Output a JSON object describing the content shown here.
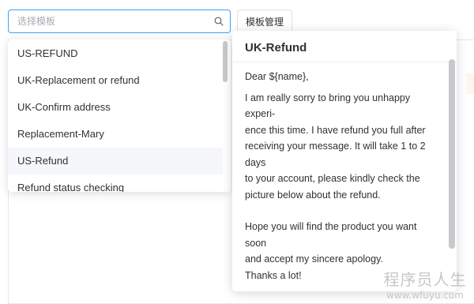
{
  "search": {
    "placeholder": "选择模板",
    "icon": "search-icon"
  },
  "toolbar": {
    "manage_label": "模板管理"
  },
  "dropdown": {
    "items": [
      {
        "label": "US-REFUND"
      },
      {
        "label": "UK-Replacement or refund"
      },
      {
        "label": "UK-Confirm address"
      },
      {
        "label": "Replacement-Mary"
      },
      {
        "label": "US-Refund"
      },
      {
        "label": "Refund status checking"
      }
    ],
    "hovered_index": 4
  },
  "preview": {
    "title": "UK-Refund",
    "greeting": "Dear ${name},",
    "lines_1": [
      "I am really sorry to bring you unhappy experi-",
      "ence this time. I have refund you full after",
      "receiving your message. It will take 1 to 2 days",
      "to your account, please kindly check the",
      "picture below about the refund."
    ],
    "lines_2": [
      "Hope you will find the product you want soon",
      "and accept my sincere apology.",
      "Thanks a lot!"
    ]
  },
  "watermark": {
    "main": "程序员人生",
    "url": "www.wfuyu.com"
  },
  "colors": {
    "accent": "#409eff",
    "hover_bg": "#f5f7fa",
    "text": "#303133"
  }
}
